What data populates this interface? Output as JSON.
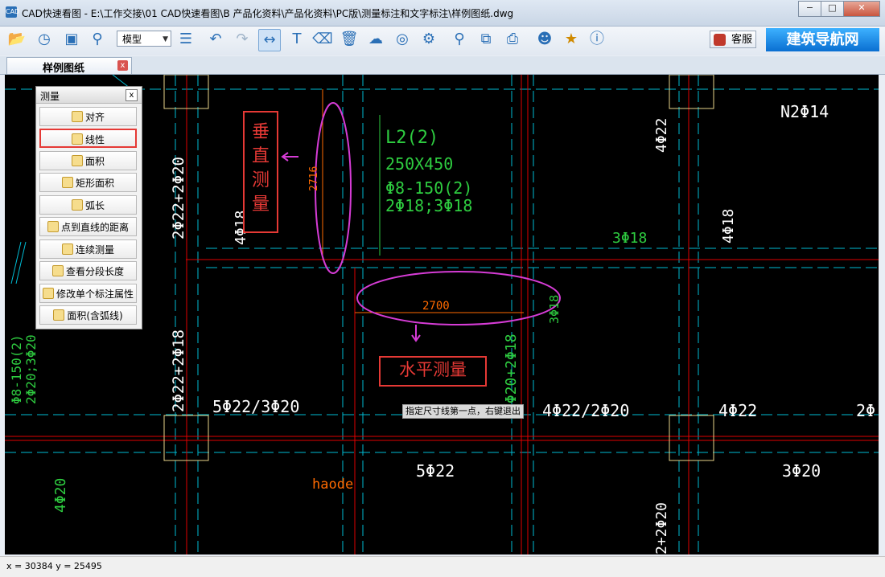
{
  "window": {
    "app_logo": "CAD",
    "title": "CAD快速看图 - E:\\工作交接\\01 CAD快速看图\\B 产品化资料\\产品化资料\\PC版\\测量标注和文字标注\\样例图纸.dwg",
    "minimize": "−",
    "maximize": "□",
    "close": "✕"
  },
  "toolbar": {
    "icons": [
      "open-folder-icon",
      "history-icon",
      "fullscreen-icon",
      "zoom-window-icon",
      "layers-icon",
      "undo-icon",
      "redo-icon",
      "measure-icon",
      "text-icon",
      "eraser-icon",
      "delete-icon",
      "cloud-upload-icon",
      "hide-icon",
      "settings-icon",
      "find-text-icon",
      "copy-icon",
      "print-icon",
      "user-icon",
      "vip-icon",
      "info-icon"
    ],
    "mode_value": "模型",
    "mode_arrow": "▼",
    "service_label": "客服",
    "banner_label": "建筑导航网"
  },
  "tab": {
    "label": "样例图纸",
    "close": "x"
  },
  "panel": {
    "title": "测量",
    "close": "x",
    "items": [
      "对齐",
      "线性",
      "面积",
      "矩形面积",
      "弧长",
      "点到直线的距离",
      "连续测量",
      "查看分段长度",
      "修改单个标注属性",
      "面积(含弧线)"
    ],
    "selected_index": 1
  },
  "drawing": {
    "labels": {
      "beam_name": "L2(2)",
      "beam_size": "250X450",
      "stirrup": "Φ8-150(2)",
      "bars": "2Φ18;3Φ18",
      "top_right": "N2Φ14",
      "col_a": "4Φ22",
      "col_b": "4Φ18",
      "left_a": "2Φ22+2Φ20",
      "left_b": "4Φ18",
      "mid_a": "3Φ18",
      "small_a": "3Φ18",
      "left_c": "2Φ22+2Φ18",
      "left_d": "Φ8-150(2)",
      "left_e": "2Φ20;3Φ20",
      "mid_b": "2Φ20+2Φ18",
      "row_a": "5Φ22/3Φ20",
      "row_b": "4Φ22/2Φ20",
      "row_c": "4Φ22",
      "row_d": "2Φ",
      "row_e": "5Φ22",
      "row_f": "3Φ20",
      "row_g": "4Φ20",
      "row_h": "2+2Φ20",
      "haode": "haode",
      "dim_vertical": "2716",
      "dim_horizontal": "2700"
    },
    "annotations": {
      "vertical": "垂直测量",
      "horizontal": "水平测量"
    },
    "tooltip": "指定尺寸线第一点，右键退出",
    "colors": {
      "background": "#000000",
      "axis_red": "#e00000",
      "grid_cyan": "#00bcd4",
      "text_green": "#2ecc40",
      "text_white": "#ffffff",
      "dim_orange": "#ff6a00",
      "ellipse_magenta": "#d63cd6",
      "column_yellow": "#e8d58a"
    }
  },
  "status": {
    "coords": "x = 30384  y = 25495"
  }
}
